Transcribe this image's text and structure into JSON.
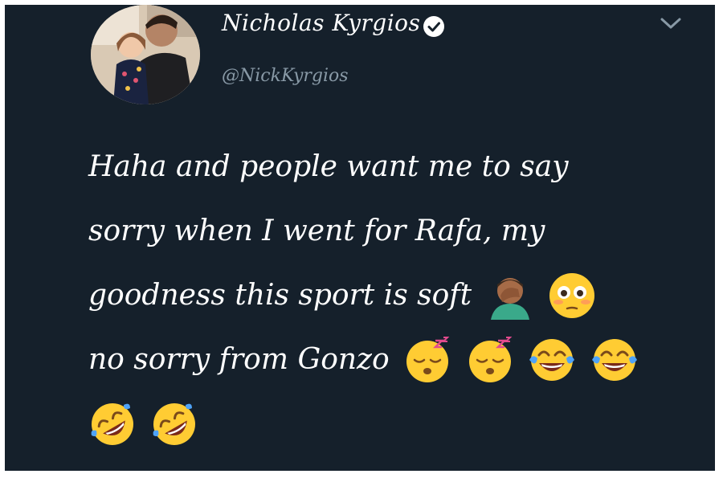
{
  "user": {
    "display_name": "Nicholas Kyrgios",
    "handle": "@NickKyrgios",
    "verified": true
  },
  "tweet": {
    "lines": [
      "Haha and people want me to say",
      "sorry when I went for Rafa, my",
      "goodness this sport is soft",
      "no sorry from Gonzo",
      ""
    ],
    "emojis": {
      "line3": [
        "facepalm-icon",
        "flushed-face-icon"
      ],
      "line4": [
        "sleeping-face-icon",
        "sleeping-face-icon",
        "tears-of-joy-icon",
        "tears-of-joy-icon"
      ],
      "line5": [
        "rolling-laughing-icon",
        "rolling-laughing-icon"
      ]
    }
  },
  "colors": {
    "background": "#15202b",
    "text": "#ffffff",
    "handle": "#8899a6",
    "emoji_yellow": "#ffcc33"
  }
}
